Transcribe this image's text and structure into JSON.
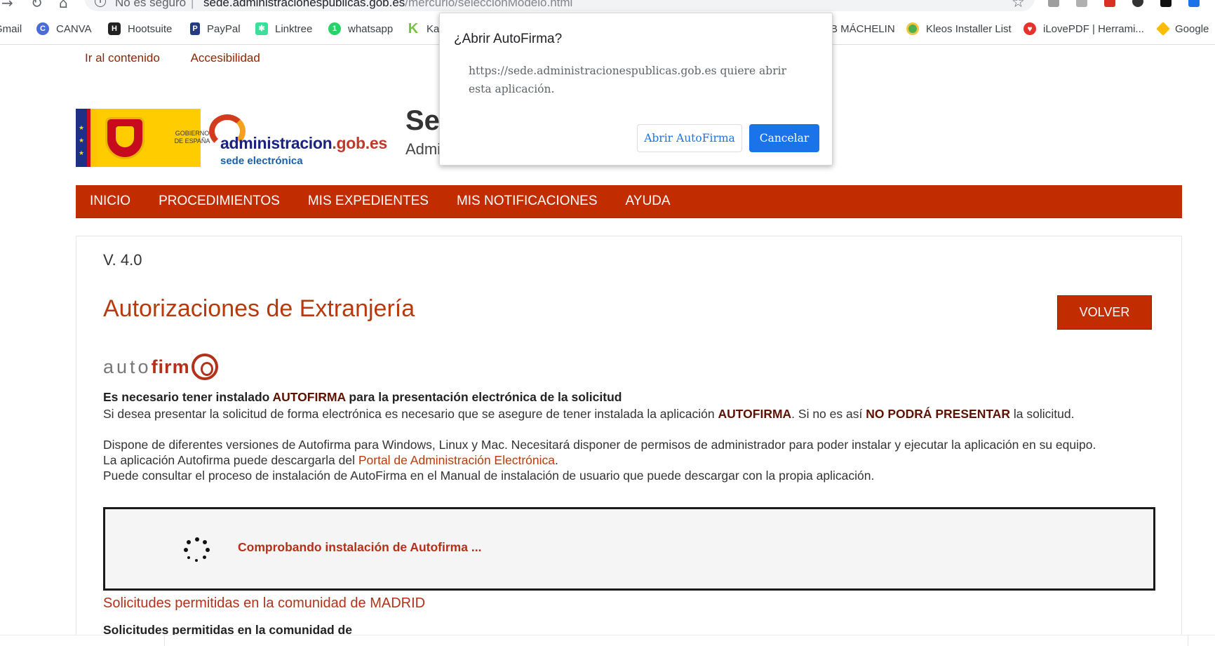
{
  "browser": {
    "address": {
      "security_label": "No es seguro",
      "separator": "|",
      "host": "sede.administracionespublicas.gob.es",
      "path": "/mercurio/seleccionModelo.html"
    },
    "bookmarks": [
      {
        "label": "Gmail",
        "icon": "gmail-icon",
        "color": "#ea4335"
      },
      {
        "label": "CANVA",
        "icon": "canva-icon",
        "color": "#4b6bd8"
      },
      {
        "label": "Hootsuite",
        "icon": "hootsuite-icon",
        "color": "#222222"
      },
      {
        "label": "PayPal",
        "icon": "paypal-icon",
        "color": "#253b80"
      },
      {
        "label": "Linktree",
        "icon": "linktree-icon",
        "color": "#39e09b"
      },
      {
        "label": "whatsapp",
        "icon": "whatsapp-icon",
        "color": "#25d366"
      },
      {
        "label": "Ka",
        "icon": "kajabi-icon",
        "color": "#7bc043"
      },
      {
        "label": "B MÁCHELIN",
        "icon": "bookmark-icon",
        "color": "#888888"
      },
      {
        "label": "Kleos Installer List",
        "icon": "kleos-icon",
        "color": "#4caf50"
      },
      {
        "label": "iLovePDF | Herrami...",
        "icon": "ilovepdf-icon",
        "color": "#e5322d"
      },
      {
        "label": "Google",
        "icon": "google-drive-icon",
        "color": "#fbbc04"
      }
    ]
  },
  "dialog": {
    "title": "¿Abrir AutoFirma?",
    "message": "https://sede.administracionespublicas.gob.es quiere abrir esta aplicación.",
    "open_label": "Abrir AutoFirma",
    "cancel_label": "Cancelar"
  },
  "page": {
    "skip_links": [
      "Ir al contenido",
      "Accesibilidad"
    ],
    "logo": {
      "gov_text": "GOBIERNO DE ESPAÑA",
      "admin_main_a": "administracion",
      "admin_main_b": ".gob.es",
      "admin_sub": "sede electrónica"
    },
    "site_title": "Se",
    "site_subtitle": "Admi",
    "nav": [
      "INICIO",
      "PROCEDIMIENTOS",
      "MIS EXPEDIENTES",
      "MIS NOTIFICACIONES",
      "AYUDA"
    ],
    "version": "V. 4.0",
    "title": "Autorizaciones de Extranjería",
    "back_button": "VOLVER",
    "autofirma_logo": {
      "part1": "auto",
      "part2": "firm"
    },
    "req": {
      "a": "Es necesario tener instalado ",
      "b": "AUTOFIRMA",
      "c": " para la presentación electrónica de la solicitud"
    },
    "line2": {
      "a": "Si desea presentar la solicitud de forma electrónica es necesario que se asegure de tener instalada la aplicación ",
      "b": "AUTOFIRMA",
      "c": ". Si no es así ",
      "d": "NO PODRÁ PRESENTAR",
      "e": " la solicitud."
    },
    "line3": "Dispone de diferentes versiones de Autofirma para Windows, Linux y Mac. Necesitará disponer de permisos de administrador para poder instalar y ejecutar la aplicación en su equipo.",
    "line4": {
      "a": "La aplicación Autofirma puede descargarla del ",
      "link": "Portal de Administración Electrónica",
      "b": "."
    },
    "line5": "Puede consultar el proceso de instalación de AutoFirma en el Manual de instalación de usuario que puede descargar con la propia aplicación.",
    "checking": "Comprobando instalación de Autofirma ...",
    "solicitudes_link": "Solicitudes permitidas en la comunidad de MADRID",
    "solicitudes_heading": "Solicitudes permitidas en la comunidad de"
  },
  "colors": {
    "brand_red": "#c22d00",
    "title_red": "#b83a0c",
    "dialog_blue": "#1a73e8"
  }
}
